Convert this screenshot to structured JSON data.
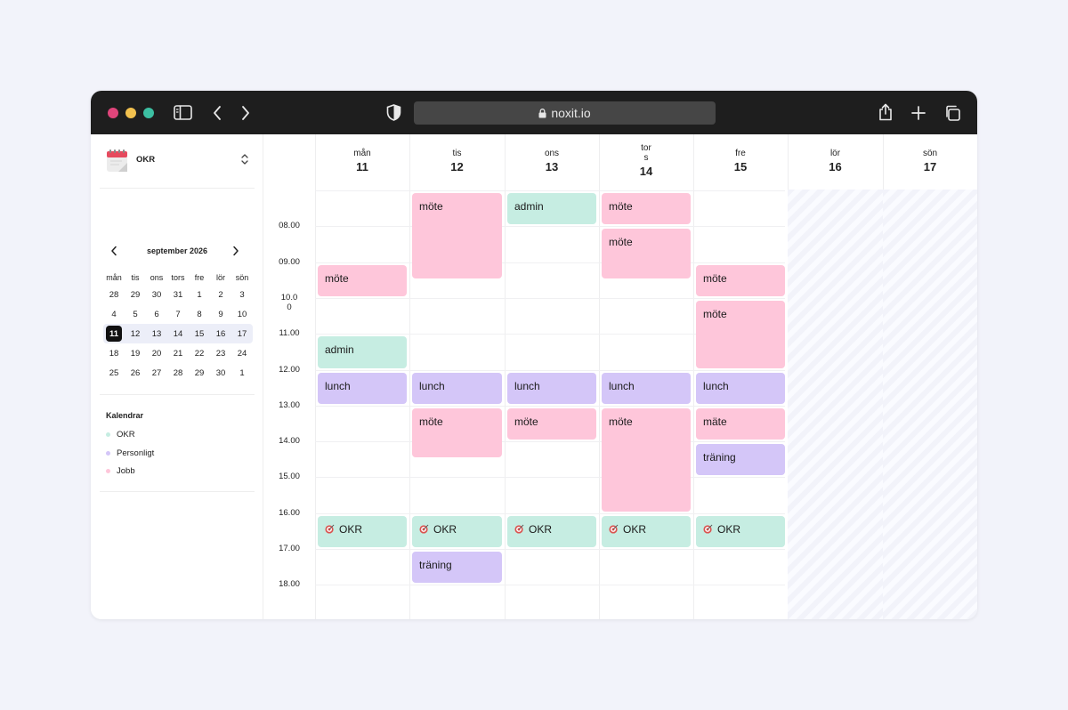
{
  "browser": {
    "url": "noxit.io",
    "traffic_lights": [
      "#e0457b",
      "#f2c14e",
      "#3cbfa2"
    ]
  },
  "sidebar": {
    "calendar_select_label": "OKR",
    "mini_calendar": {
      "month_label": "september 2026",
      "weekdays": [
        "mån",
        "tis",
        "ons",
        "tors",
        "fre",
        "lör",
        "sön"
      ],
      "weeks": [
        [
          "28",
          "29",
          "30",
          "31",
          "1",
          "2",
          "3"
        ],
        [
          "4",
          "5",
          "6",
          "7",
          "8",
          "9",
          "10"
        ],
        [
          "11",
          "12",
          "13",
          "14",
          "15",
          "16",
          "17"
        ],
        [
          "18",
          "19",
          "20",
          "21",
          "22",
          "23",
          "24"
        ],
        [
          "25",
          "26",
          "27",
          "28",
          "29",
          "30",
          "1"
        ]
      ],
      "current_week_index": 2,
      "today": "11"
    },
    "calendars_title": "Kalendrar",
    "calendars": [
      {
        "name": "OKR",
        "color": "#c6ede2"
      },
      {
        "name": "Personligt",
        "color": "#d4c6f8"
      },
      {
        "name": "Jobb",
        "color": "#fec6da"
      }
    ]
  },
  "week": {
    "days": [
      {
        "name": "mån",
        "num": "11"
      },
      {
        "name": "tis",
        "num": "12"
      },
      {
        "name": "ons",
        "num": "13"
      },
      {
        "name": "tor\ns",
        "num": "14"
      },
      {
        "name": "fre",
        "num": "15"
      },
      {
        "name": "lör",
        "num": "16"
      },
      {
        "name": "sön",
        "num": "17"
      }
    ],
    "times": [
      "08.00",
      "09.00",
      "10.0\n0",
      "11.00",
      "12.00",
      "13.00",
      "14.00",
      "15.00",
      "16.00",
      "17.00",
      "18.00"
    ]
  },
  "colors": {
    "jobb": "#fec6da",
    "okr": "#c6ede2",
    "personligt": "#d4c6f8",
    "today_badge": "#111111"
  },
  "events": [
    {
      "day": 0,
      "title": "möte",
      "cal": "pink",
      "start": 9.0,
      "end": 10.0
    },
    {
      "day": 0,
      "title": "admin",
      "cal": "green",
      "start": 11.0,
      "end": 12.0
    },
    {
      "day": 0,
      "title": "lunch",
      "cal": "purple",
      "start": 12.0,
      "end": 13.0
    },
    {
      "day": 0,
      "title": "OKR",
      "cal": "green",
      "start": 16.0,
      "end": 17.0,
      "icon": true
    },
    {
      "day": 1,
      "title": "möte",
      "cal": "pink",
      "start": 7.0,
      "end": 9.5
    },
    {
      "day": 1,
      "title": "lunch",
      "cal": "purple",
      "start": 12.0,
      "end": 13.0
    },
    {
      "day": 1,
      "title": "möte",
      "cal": "pink",
      "start": 13.0,
      "end": 14.5
    },
    {
      "day": 1,
      "title": "OKR",
      "cal": "green",
      "start": 16.0,
      "end": 17.0,
      "icon": true
    },
    {
      "day": 1,
      "title": "träning",
      "cal": "purple",
      "start": 17.0,
      "end": 18.0
    },
    {
      "day": 2,
      "title": "admin",
      "cal": "green",
      "start": 7.0,
      "end": 8.0
    },
    {
      "day": 2,
      "title": "lunch",
      "cal": "purple",
      "start": 12.0,
      "end": 13.0
    },
    {
      "day": 2,
      "title": "möte",
      "cal": "pink",
      "start": 13.0,
      "end": 14.0
    },
    {
      "day": 2,
      "title": "OKR",
      "cal": "green",
      "start": 16.0,
      "end": 17.0,
      "icon": true
    },
    {
      "day": 3,
      "title": "möte",
      "cal": "pink",
      "start": 7.0,
      "end": 8.0
    },
    {
      "day": 3,
      "title": "möte",
      "cal": "pink",
      "start": 8.0,
      "end": 9.5
    },
    {
      "day": 3,
      "title": "lunch",
      "cal": "purple",
      "start": 12.0,
      "end": 13.0
    },
    {
      "day": 3,
      "title": "möte",
      "cal": "pink",
      "start": 13.0,
      "end": 16.0
    },
    {
      "day": 3,
      "title": "OKR",
      "cal": "green",
      "start": 16.0,
      "end": 17.0,
      "icon": true
    },
    {
      "day": 4,
      "title": "möte",
      "cal": "pink",
      "start": 9.0,
      "end": 10.0
    },
    {
      "day": 4,
      "title": "möte",
      "cal": "pink",
      "start": 10.0,
      "end": 12.0
    },
    {
      "day": 4,
      "title": "lunch",
      "cal": "purple",
      "start": 12.0,
      "end": 13.0
    },
    {
      "day": 4,
      "title": "mäte",
      "cal": "pink",
      "start": 13.0,
      "end": 14.0
    },
    {
      "day": 4,
      "title": "träning",
      "cal": "purple",
      "start": 14.0,
      "end": 15.0
    },
    {
      "day": 4,
      "title": "OKR",
      "cal": "green",
      "start": 16.0,
      "end": 17.0,
      "icon": true
    }
  ]
}
